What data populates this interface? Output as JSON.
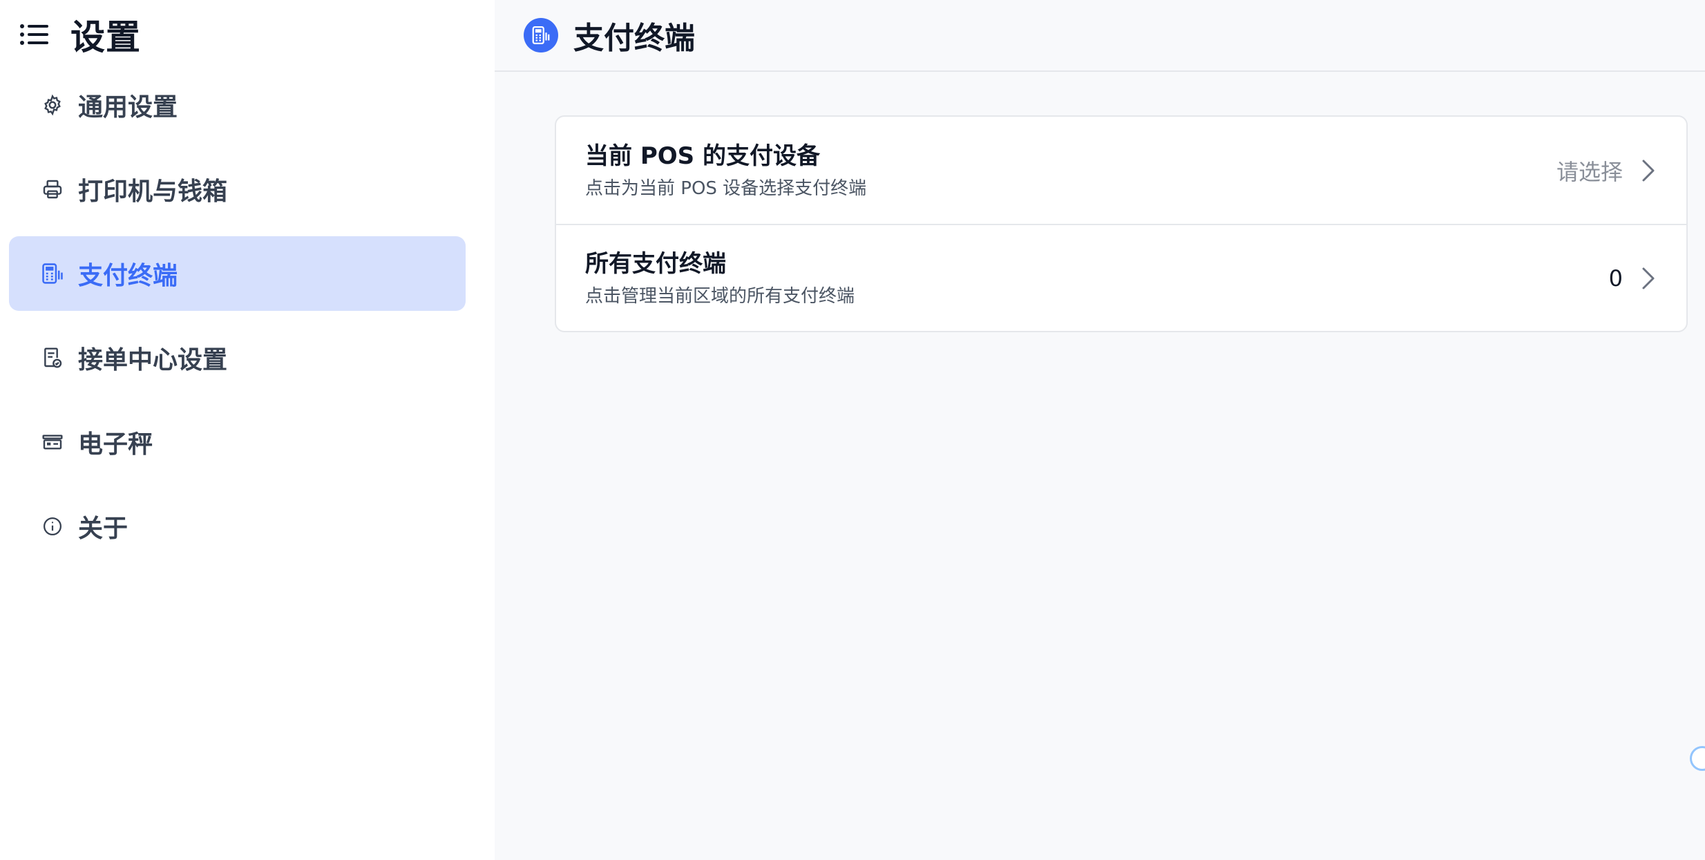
{
  "sidebar": {
    "title": "设置",
    "items": [
      {
        "label": "通用设置",
        "icon": "gear-icon"
      },
      {
        "label": "打印机与钱箱",
        "icon": "printer-icon"
      },
      {
        "label": "支付终端",
        "icon": "pos-terminal-icon",
        "active": true
      },
      {
        "label": "接单中心设置",
        "icon": "order-doc-icon"
      },
      {
        "label": "电子秤",
        "icon": "scale-icon"
      },
      {
        "label": "关于",
        "icon": "info-icon"
      }
    ]
  },
  "header": {
    "title": "支付终端",
    "icon": "pos-terminal-icon"
  },
  "settings": {
    "rows": [
      {
        "title": "当前 POS 的支付设备",
        "subtitle": "点击为当前 POS 设备选择支付终端",
        "value": "请选择"
      },
      {
        "title": "所有支付终端",
        "subtitle": "点击管理当前区域的所有支付终端",
        "value": "0"
      }
    ]
  },
  "colors": {
    "accent": "#3b6cf6",
    "active_bg": "#d6e0fd",
    "main_bg": "#f8f9fb",
    "border": "#e5e7eb"
  }
}
